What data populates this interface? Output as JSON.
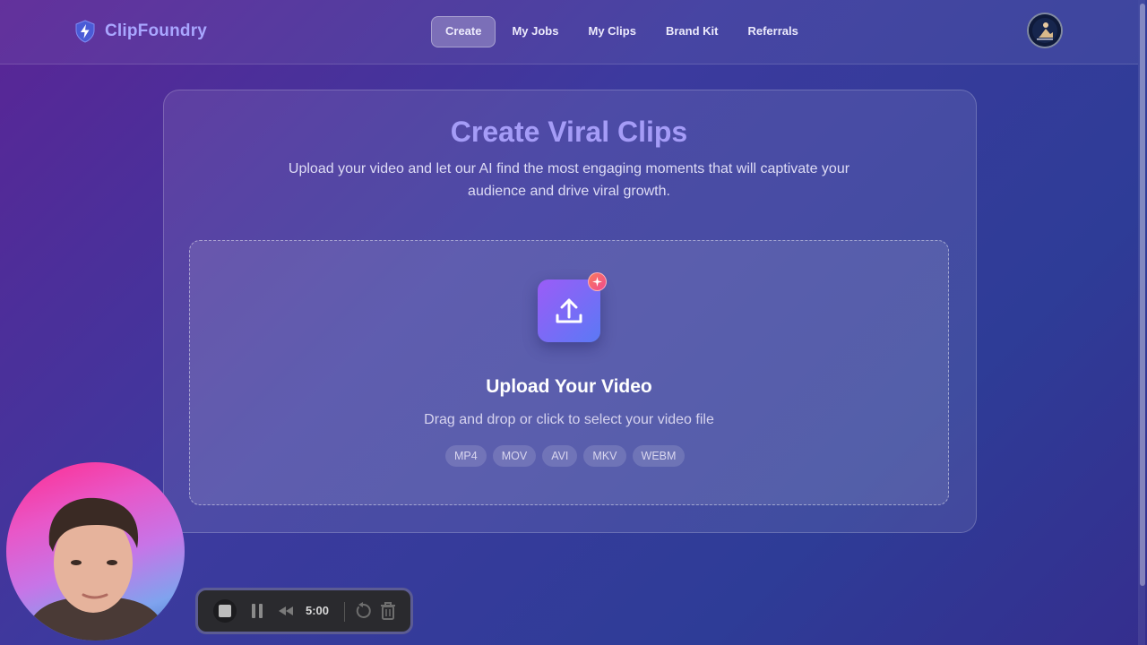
{
  "header": {
    "brand": "ClipFoundry",
    "nav": [
      {
        "label": "Create",
        "active": true
      },
      {
        "label": "My Jobs",
        "active": false
      },
      {
        "label": "My Clips",
        "active": false
      },
      {
        "label": "Brand Kit",
        "active": false
      },
      {
        "label": "Referrals",
        "active": false
      }
    ]
  },
  "main": {
    "title": "Create Viral Clips",
    "subtitle": "Upload your video and let our AI find the most engaging moments that will captivate your audience and drive viral growth.",
    "upload": {
      "title": "Upload Your Video",
      "hint": "Drag and drop or click to select your video file",
      "formats": [
        "MP4",
        "MOV",
        "AVI",
        "MKV",
        "WEBM"
      ]
    }
  },
  "recorder": {
    "time": "5:00",
    "icons": [
      "stop-icon",
      "pause-icon",
      "rewind-icon",
      "restart-icon",
      "trash-icon"
    ]
  },
  "colors": {
    "brand_text": "#a9a6ff",
    "title": "#a59cf7",
    "upload_tile_start": "#9b5cf7",
    "upload_tile_end": "#5b79f5",
    "badge": "#f04a8f"
  }
}
